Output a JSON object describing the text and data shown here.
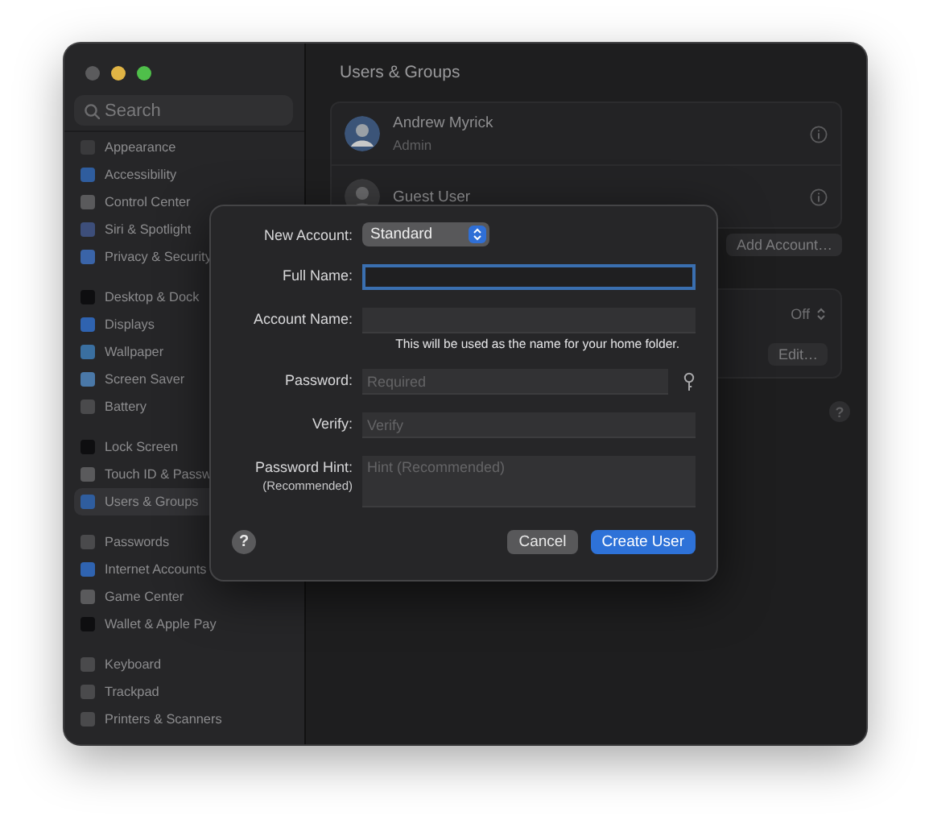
{
  "window": {
    "search": {
      "placeholder": "Search"
    }
  },
  "sidebar": {
    "groups": [
      {
        "items": [
          {
            "label": "Appearance",
            "color": "#3a3a3c",
            "selected": false
          },
          {
            "label": "Accessibility",
            "color": "#2f5d9e",
            "selected": false
          },
          {
            "label": "Control Center",
            "color": "#5a5a5c",
            "selected": false
          },
          {
            "label": "Siri & Spotlight",
            "color": "#3d4e7a",
            "selected": false
          },
          {
            "label": "Privacy & Security",
            "color": "#3a64a8",
            "selected": false
          }
        ]
      },
      {
        "items": [
          {
            "label": "Desktop & Dock",
            "color": "#0e0e10",
            "selected": false
          },
          {
            "label": "Displays",
            "color": "#2f63b0",
            "selected": false
          },
          {
            "label": "Wallpaper",
            "color": "#3a6fa0",
            "selected": false
          },
          {
            "label": "Screen Saver",
            "color": "#4a78a8",
            "selected": false
          },
          {
            "label": "Battery",
            "color": "#4a4a4c",
            "selected": false
          }
        ]
      },
      {
        "items": [
          {
            "label": "Lock Screen",
            "color": "#0e0e10",
            "selected": false
          },
          {
            "label": "Touch ID & Passw",
            "color": "#5a5a5c",
            "selected": false
          },
          {
            "label": "Users & Groups",
            "color": "#2f5d9e",
            "selected": true
          }
        ]
      },
      {
        "items": [
          {
            "label": "Passwords",
            "color": "#4a4a4c",
            "selected": false
          },
          {
            "label": "Internet Accounts",
            "color": "#2f63b0",
            "selected": false
          },
          {
            "label": "Game Center",
            "color": "#5a5a5c",
            "selected": false
          },
          {
            "label": "Wallet & Apple Pay",
            "color": "#0e0e10",
            "selected": false
          }
        ]
      },
      {
        "items": [
          {
            "label": "Keyboard",
            "color": "#4a4a4c",
            "selected": false
          },
          {
            "label": "Trackpad",
            "color": "#4a4a4c",
            "selected": false
          },
          {
            "label": "Printers & Scanners",
            "color": "#4a4a4c",
            "selected": false
          }
        ]
      }
    ]
  },
  "pane": {
    "title": "Users & Groups",
    "users": [
      {
        "name": "Andrew Myrick",
        "role": "Admin",
        "kind": "photo"
      },
      {
        "name": "Guest User",
        "kind": "guest"
      }
    ],
    "add_button": "Add Account…",
    "settings": [
      {
        "kind": "stepper",
        "value": "Off"
      },
      {
        "kind": "button",
        "value": "Edit…"
      }
    ],
    "help": "?"
  },
  "dialog": {
    "account_type": {
      "label": "New Account:",
      "value": "Standard"
    },
    "fields": [
      {
        "kind": "text",
        "label": "Full Name:",
        "focused": true
      },
      {
        "kind": "text",
        "label": "Account Name:",
        "focused": false,
        "note": "This will be used as the name for your home folder."
      },
      {
        "kind": "password",
        "label": "Password:",
        "placeholder": "Required",
        "focused": false
      },
      {
        "kind": "text",
        "label": "Verify:",
        "placeholder": "Verify",
        "focused": false
      },
      {
        "kind": "textarea",
        "label": "Password Hint:",
        "sublabel": "(Recommended)",
        "placeholder": "Hint (Recommended)",
        "focused": false
      }
    ],
    "help": "?",
    "buttons": [
      {
        "label": "Cancel",
        "kind": "cancel"
      },
      {
        "label": "Create User",
        "kind": "default"
      }
    ]
  }
}
